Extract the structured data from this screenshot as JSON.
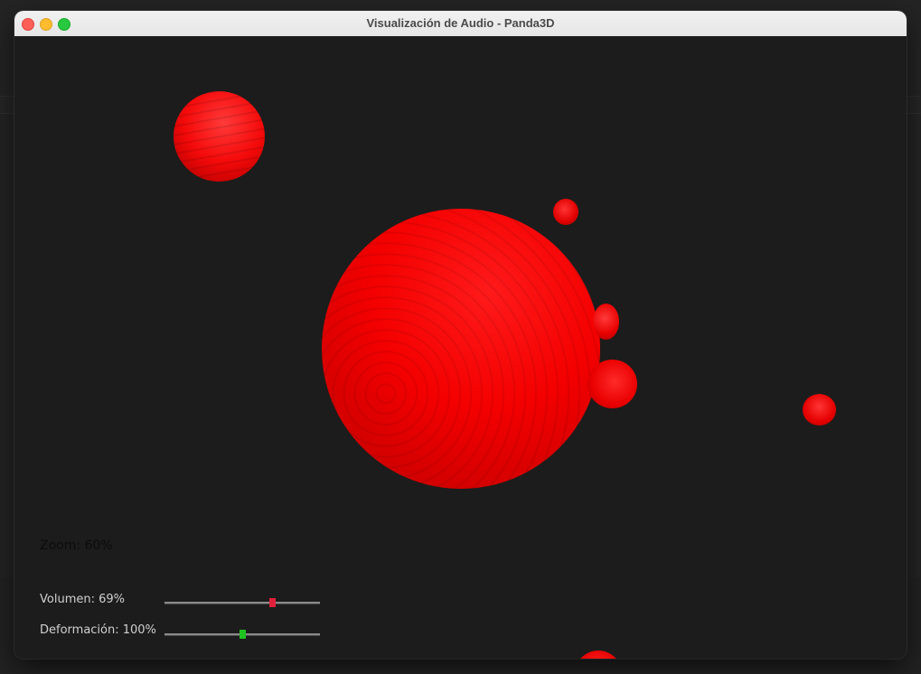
{
  "window": {
    "title": "Visualización de Audio - Panda3D"
  },
  "scene": {
    "background_color": "#1c1c1c",
    "sphere_color": "#ff0000",
    "spheres": [
      {
        "name": "center-large"
      },
      {
        "name": "top-left"
      },
      {
        "name": "small-right-1"
      },
      {
        "name": "small-right-2"
      },
      {
        "name": "small-right-3"
      },
      {
        "name": "far-right"
      },
      {
        "name": "bottom-partial"
      }
    ]
  },
  "hud": {
    "zoom_label": "Zoom: 60%",
    "zoom_value": 60,
    "volume": {
      "label": "Volumen: 69%",
      "value": 0.69,
      "thumb_color": "#e0213b"
    },
    "deformation": {
      "label": "Deformación: 100%",
      "value": 0.5,
      "thumb_color": "#1fc21f"
    }
  }
}
